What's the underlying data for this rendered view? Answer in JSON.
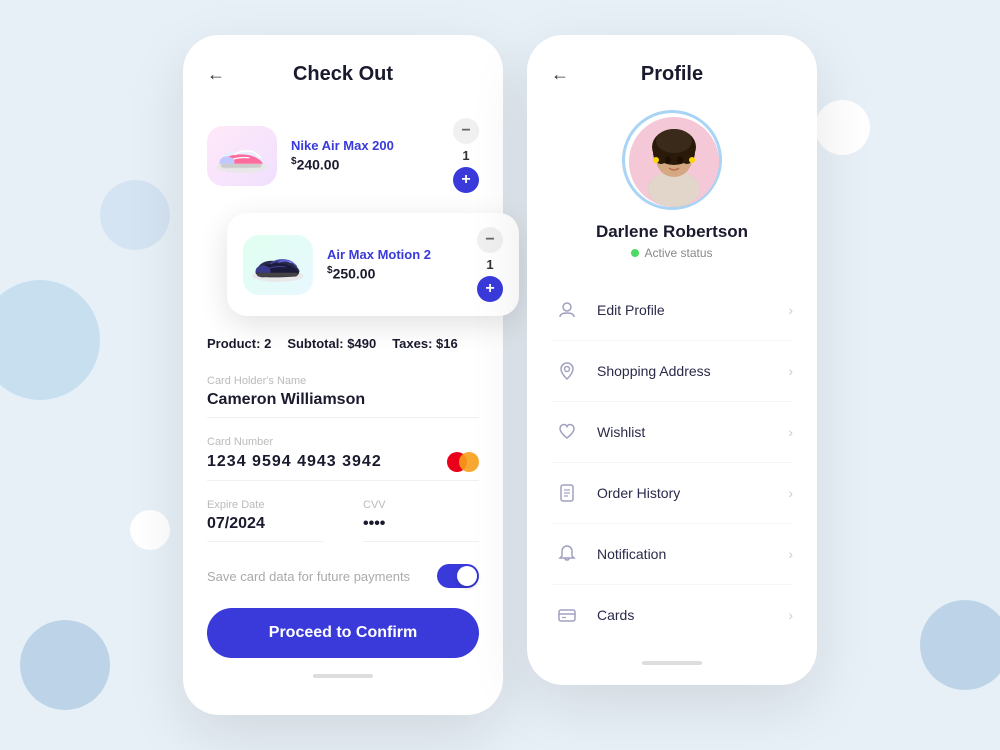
{
  "background": {
    "color": "#e8f0f7"
  },
  "checkout": {
    "title": "Check Out",
    "back_arrow": "←",
    "products": [
      {
        "name": "Nike Air Max 200",
        "price": "240.00",
        "currency": "$",
        "quantity": 1,
        "image_bg": "linear-gradient(135deg,#ffe8f8,#f0e0ff)"
      },
      {
        "name": "Air Max Motion 2",
        "price": "250.00",
        "currency": "$",
        "quantity": 1,
        "image_bg": "linear-gradient(135deg,#e0fff0,#e8f8ff)"
      }
    ],
    "summary": {
      "product_label": "Product:",
      "product_count": "2",
      "subtotal_label": "Subtotal:",
      "subtotal_value": "$490",
      "taxes_label": "Taxes:",
      "taxes_value": "$16"
    },
    "card_holder": {
      "label": "Card Holder's Name",
      "value": "Cameron Williamson"
    },
    "card_number": {
      "label": "Card Number",
      "value": "1234   9594   4943   3942"
    },
    "expire_date": {
      "label": "Expire Date",
      "value": "07/2024"
    },
    "cvv": {
      "label": "CVV",
      "value": "••••"
    },
    "save_card_label": "Save card data for future payments",
    "proceed_button": "Proceed to Confirm"
  },
  "profile": {
    "title": "Profile",
    "back_arrow": "←",
    "user": {
      "name": "Darlene Robertson",
      "status": "Active status"
    },
    "menu_items": [
      {
        "label": "Edit Profile",
        "icon": "person"
      },
      {
        "label": "Shopping Address",
        "icon": "location"
      },
      {
        "label": "Wishlist",
        "icon": "heart"
      },
      {
        "label": "Order History",
        "icon": "document"
      },
      {
        "label": "Notification",
        "icon": "bell"
      },
      {
        "label": "Cards",
        "icon": "card"
      }
    ]
  }
}
